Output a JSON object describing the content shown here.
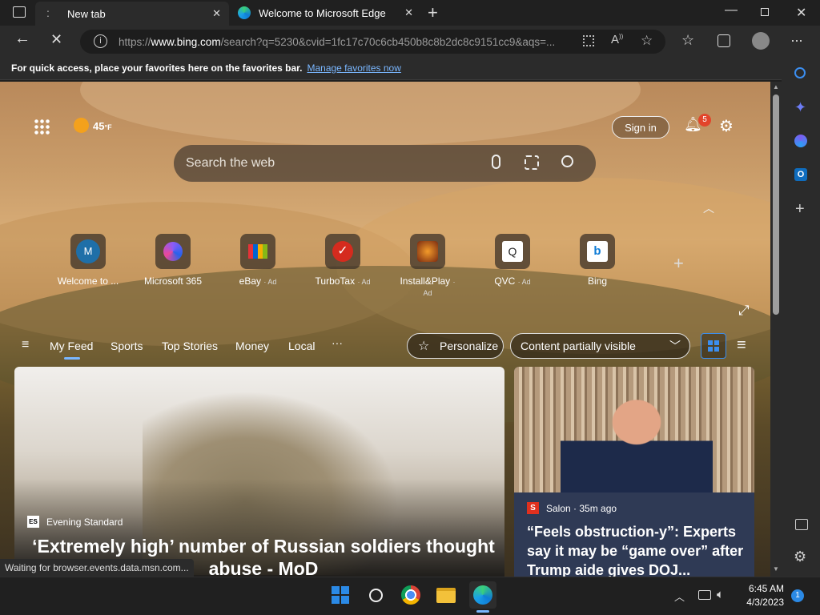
{
  "tabs": [
    {
      "label": "New tab"
    },
    {
      "label": "Welcome to Microsoft Edge"
    }
  ],
  "address": {
    "prefix": "https://",
    "domain": "www.bing.com",
    "rest": "/search?q=5230&cvid=1fc17c70c6cb450b8c8b2dc8c9151cc9&aqs=..."
  },
  "favorites_bar": {
    "text": "For quick access, place your favorites here on the favorites bar.",
    "link": "Manage favorites now"
  },
  "weather": {
    "temp": "45",
    "unit": "°F"
  },
  "header": {
    "sign_in": "Sign in",
    "notif_count": "5"
  },
  "search": {
    "placeholder": "Search the web"
  },
  "shortcuts": [
    {
      "label": "Welcome to ...",
      "ad": "",
      "letter": "M"
    },
    {
      "label": "Microsoft 365",
      "ad": ""
    },
    {
      "label": "eBay",
      "ad": "· Ad"
    },
    {
      "label": "TurboTax",
      "ad": "· Ad"
    },
    {
      "label": "Install&Play",
      "ad": "· Ad"
    },
    {
      "label": "QVC",
      "ad": "· Ad"
    },
    {
      "label": "Bing",
      "ad": ""
    }
  ],
  "feed": {
    "tabs": [
      "My Feed",
      "Sports",
      "Top Stories",
      "Money",
      "Local"
    ],
    "more": "···",
    "personalize": "Personalize",
    "visibility": "Content partially visible"
  },
  "cards": [
    {
      "source": "Evening Standard",
      "headline": "‘Extremely high’ number of Russian soldiers thought abuse - MoD"
    },
    {
      "source": "Salon · 35m ago",
      "headline": "“Feels obstruction-y”: Experts say it may be “game over” after Trump aide gives DOJ..."
    }
  ],
  "status": "Waiting for browser.events.data.msn.com...",
  "clock": {
    "time": "6:45 AM",
    "date": "4/3/2023",
    "badge": "1"
  },
  "colors": {
    "accent": "#2b8ae6",
    "edge_blue": "#0f7cd6",
    "link": "#7ab7ff"
  }
}
